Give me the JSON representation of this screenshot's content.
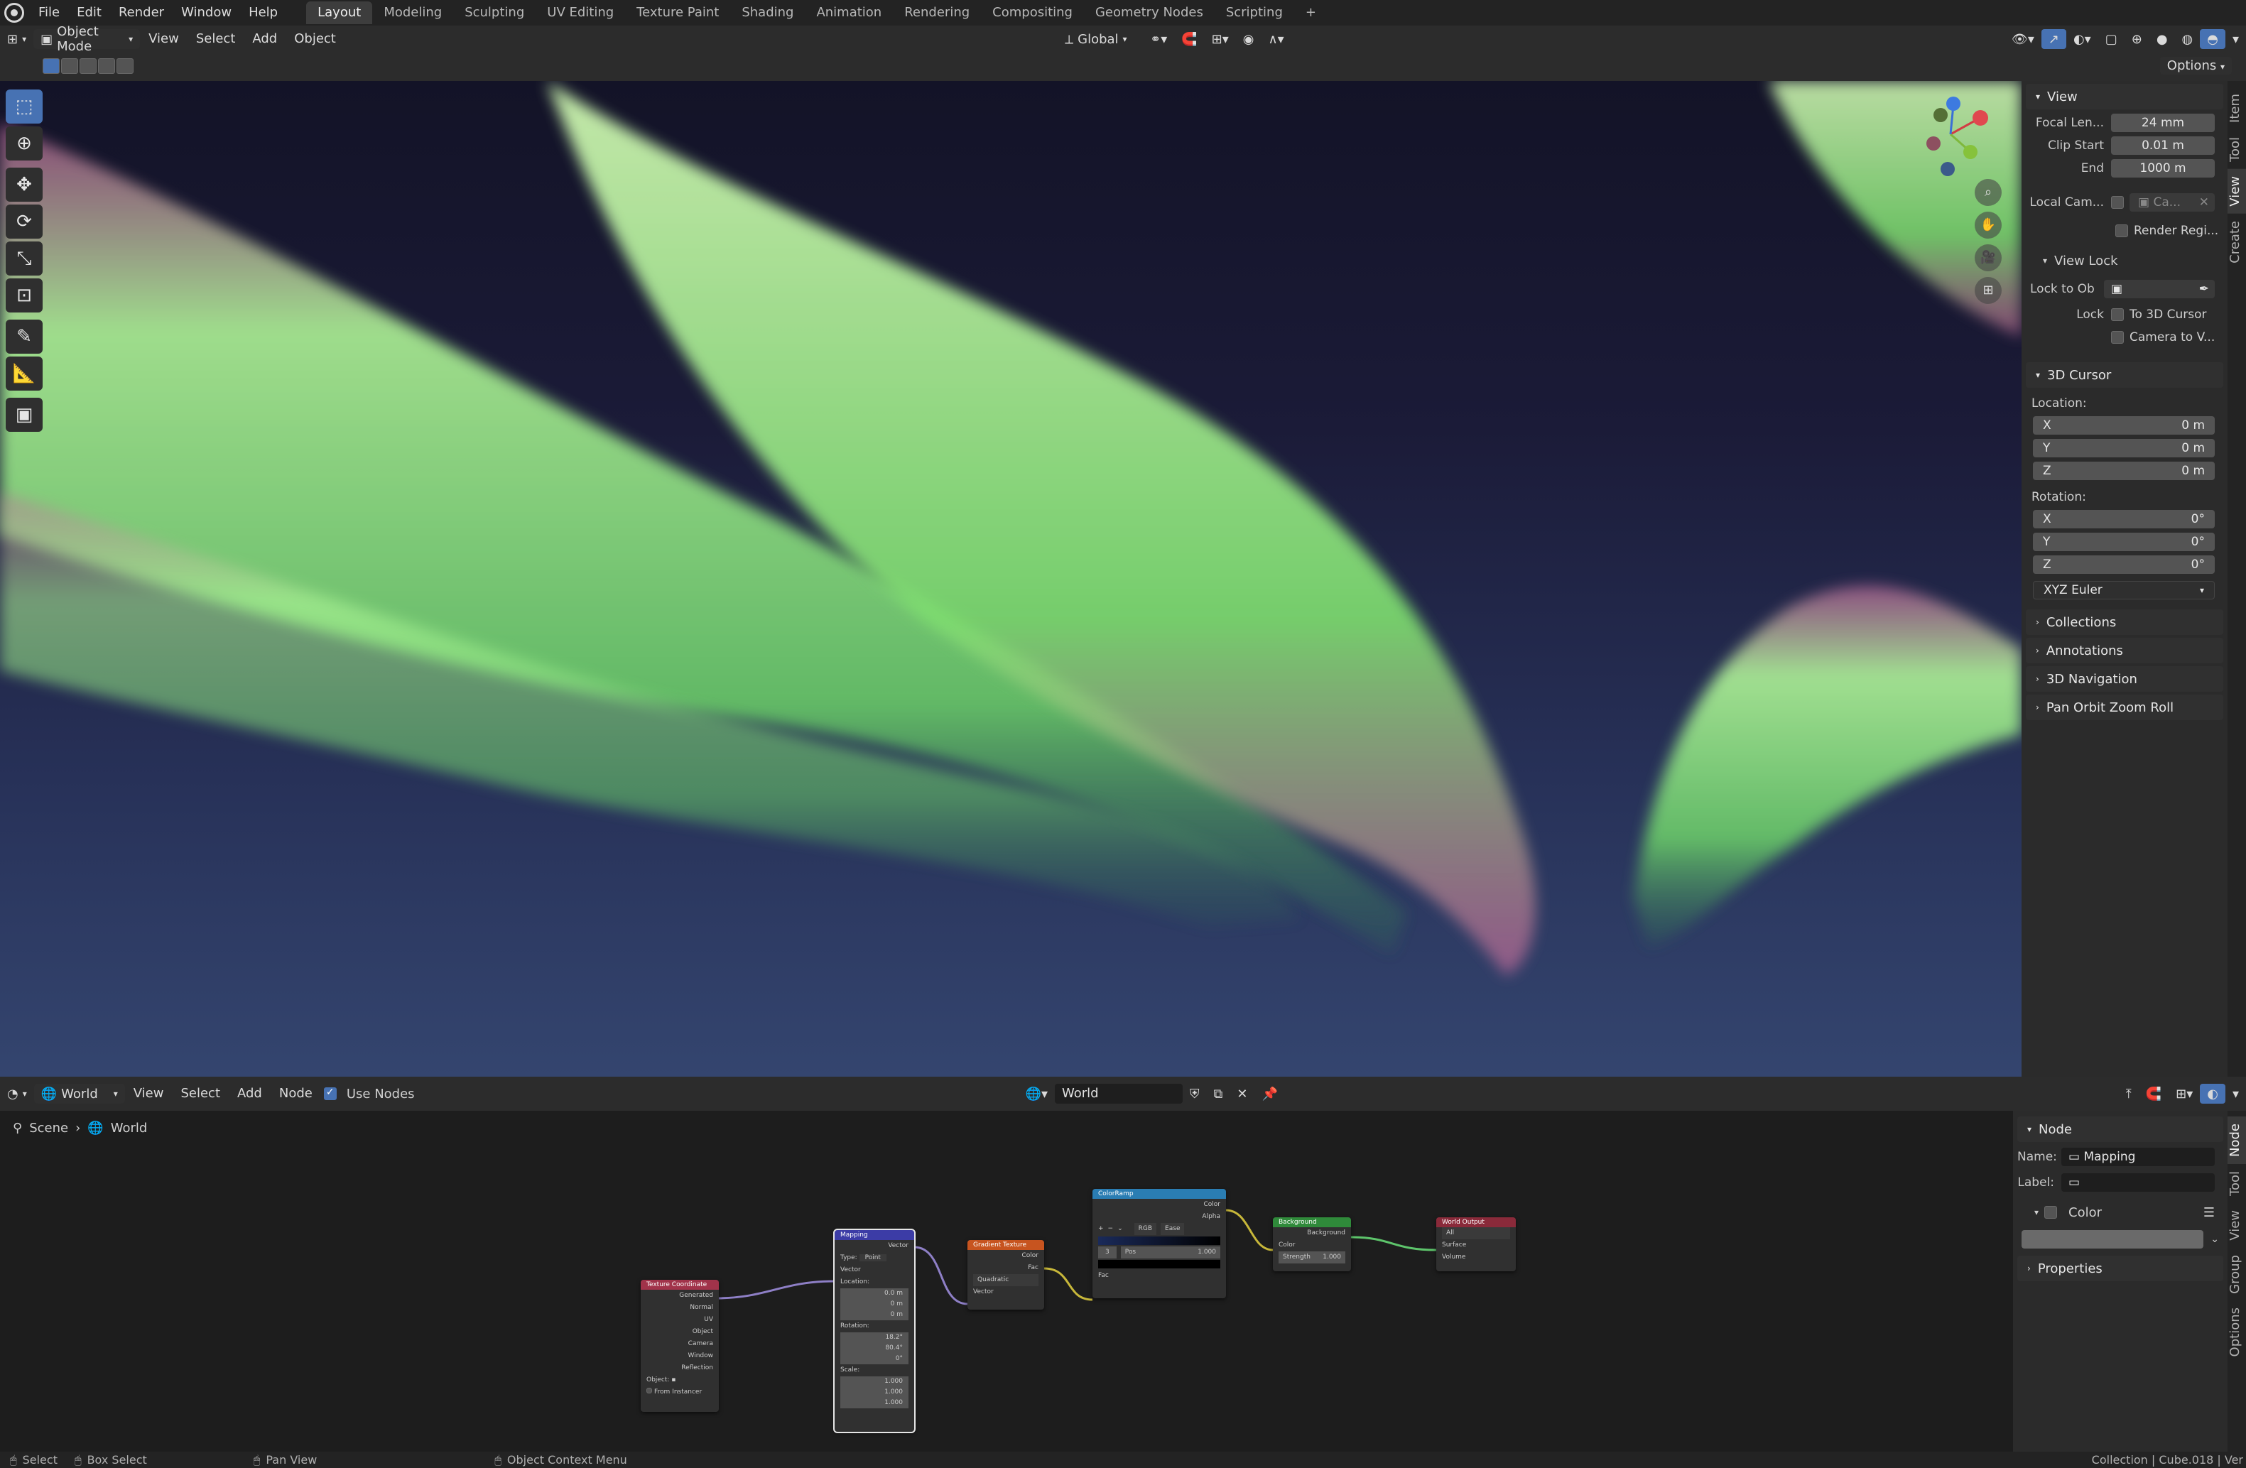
{
  "topbar": {
    "menus": [
      "File",
      "Edit",
      "Render",
      "Window",
      "Help"
    ],
    "workspaces": [
      "Layout",
      "Modeling",
      "Sculpting",
      "UV Editing",
      "Texture Paint",
      "Shading",
      "Animation",
      "Rendering",
      "Compositing",
      "Geometry Nodes",
      "Scripting"
    ],
    "active_workspace": "Layout",
    "add_tab": "+"
  },
  "viewport_header": {
    "mode": "Object Mode",
    "menus": [
      "View",
      "Select",
      "Add",
      "Object"
    ],
    "orientation": "Global",
    "options": "Options"
  },
  "npanel": {
    "tabs": [
      "Item",
      "Tool",
      "View",
      "Create"
    ],
    "active_tab": "View",
    "view": {
      "title": "View",
      "focal_label": "Focal Len...",
      "focal_value": "24 mm",
      "clip_start_label": "Clip Start",
      "clip_start_value": "0.01 m",
      "end_label": "End",
      "end_value": "1000 m",
      "local_cam_label": "Local Cam...",
      "local_cam_value": "Ca...",
      "render_region": "Render Regi...",
      "view_lock_title": "View Lock",
      "lock_to_ob_label": "Lock to Ob",
      "lock_label": "Lock",
      "to_3d_cursor": "To 3D Cursor",
      "camera_to_v": "Camera to V..."
    },
    "cursor": {
      "title": "3D Cursor",
      "location_label": "Location:",
      "loc": [
        {
          "axis": "X",
          "value": "0 m"
        },
        {
          "axis": "Y",
          "value": "0 m"
        },
        {
          "axis": "Z",
          "value": "0 m"
        }
      ],
      "rotation_label": "Rotation:",
      "rot": [
        {
          "axis": "X",
          "value": "0°"
        },
        {
          "axis": "Y",
          "value": "0°"
        },
        {
          "axis": "Z",
          "value": "0°"
        }
      ],
      "rotation_mode": "XYZ Euler"
    },
    "collapsed_panels": [
      "Collections",
      "Annotations",
      "3D Navigation",
      "Pan Orbit Zoom Roll"
    ]
  },
  "node_editor": {
    "world_type": "World",
    "menus": [
      "View",
      "Select",
      "Add",
      "Node"
    ],
    "use_nodes": "Use Nodes",
    "world_name": "World",
    "breadcrumb": [
      "Scene",
      "World"
    ],
    "npanel_tabs": [
      "Node",
      "Tool",
      "View",
      "Group",
      "Options"
    ],
    "active_tab": "Node",
    "node_panel": {
      "title": "Node",
      "name_label": "Name:",
      "name_value": "Mapping",
      "label_label": "Label:",
      "label_value": "",
      "color_title": "Color",
      "properties": "Properties"
    },
    "nodes": {
      "texcoord": {
        "title": "Texture Coordinate",
        "outputs": [
          "Generated",
          "Normal",
          "UV",
          "Object",
          "Camera",
          "Window",
          "Reflection"
        ],
        "object_label": "Object:",
        "from_instancer": "From Instancer"
      },
      "mapping": {
        "title": "Mapping",
        "out": "Vector",
        "type_label": "Type:",
        "type_value": "Point",
        "vector": "Vector",
        "location": "Location:",
        "loc": [
          "0.0 m",
          "0 m",
          "0 m"
        ],
        "rotation": "Rotation:",
        "rot": [
          "18.2°",
          "80.4°",
          "0°"
        ],
        "scale": "Scale:",
        "scl": [
          "1.000",
          "1.000",
          "1.000"
        ]
      },
      "gradient": {
        "title": "Gradient Texture",
        "outputs": [
          "Color",
          "Fac"
        ],
        "mode": "Quadratic",
        "input": "Vector"
      },
      "colorramp": {
        "title": "ColorRamp",
        "outputs": [
          "Color",
          "Alpha"
        ],
        "mode": "RGB",
        "interp": "Ease",
        "pos_label": "Pos",
        "pos_value": "1.000",
        "index": "3",
        "input": "Fac"
      },
      "background": {
        "title": "Background",
        "out": "Background",
        "color": "Color",
        "strength_label": "Strength",
        "strength_value": "1.000"
      },
      "output": {
        "title": "World Output",
        "target": "All",
        "inputs": [
          "Surface",
          "Volume"
        ]
      }
    }
  },
  "statusbar": {
    "select": "Select",
    "box_select": "Box Select",
    "pan_view": "Pan View",
    "context_menu": "Object Context Menu",
    "info": "Collection | Cube.018 | Ver"
  },
  "colors": {
    "accent": "#4772b3",
    "texcoord_head": "#a1334a",
    "mapping_head": "#3c3ca6",
    "gradient_head": "#c7541f",
    "colorramp_head": "#2a7db3",
    "background_head": "#2f8a3a",
    "output_head": "#8a2a3a"
  }
}
